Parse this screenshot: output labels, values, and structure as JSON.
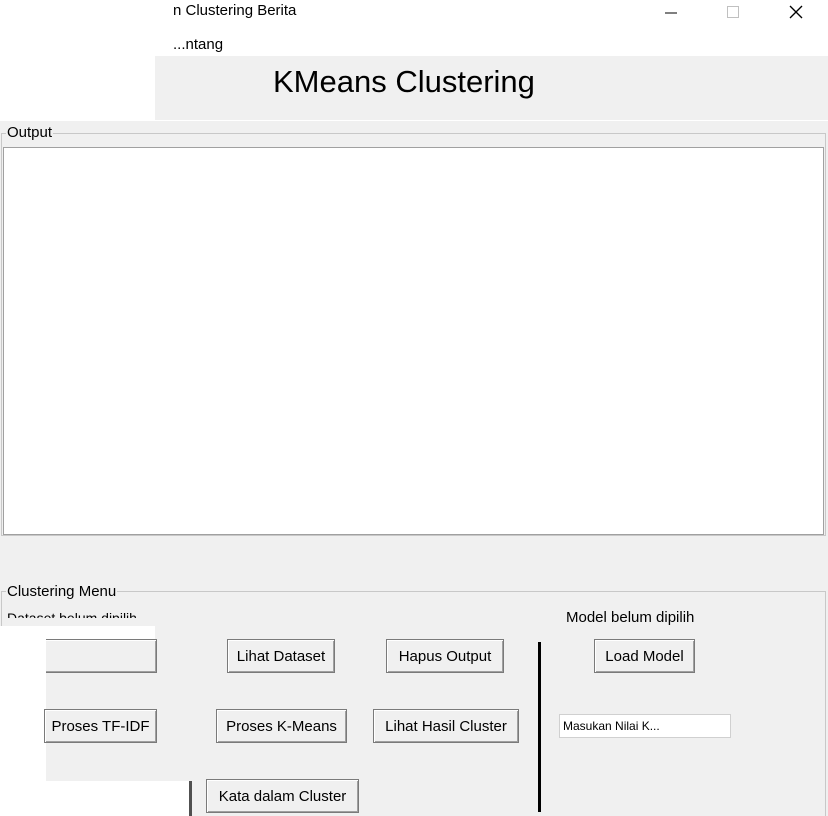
{
  "window": {
    "title": "n Clustering Berita"
  },
  "menubar": {
    "items": [
      "...ntang"
    ]
  },
  "header": {
    "title": "KMeans Clustering"
  },
  "output": {
    "label": "Output",
    "content": ""
  },
  "clustering_menu": {
    "label": "Clustering Menu",
    "dataset_status": "Dataset belum dipilih",
    "model_status": "Model belum dipilih",
    "buttons": {
      "lihat_dataset": "Lihat Dataset",
      "hapus_output": "Hapus Output",
      "load_model": "Load Model",
      "proses_tfidf": "Proses TF-IDF",
      "proses_kmeans": "Proses K-Means",
      "lihat_hasil_cluster": "Lihat Hasil Cluster",
      "kata_dalam_cluster": "Kata dalam Cluster"
    },
    "k_input": {
      "placeholder": "Masukan Nilai K..."
    }
  },
  "icons": {
    "minimize": "minimize-icon",
    "maximize": "maximize-icon",
    "close": "close-icon"
  }
}
